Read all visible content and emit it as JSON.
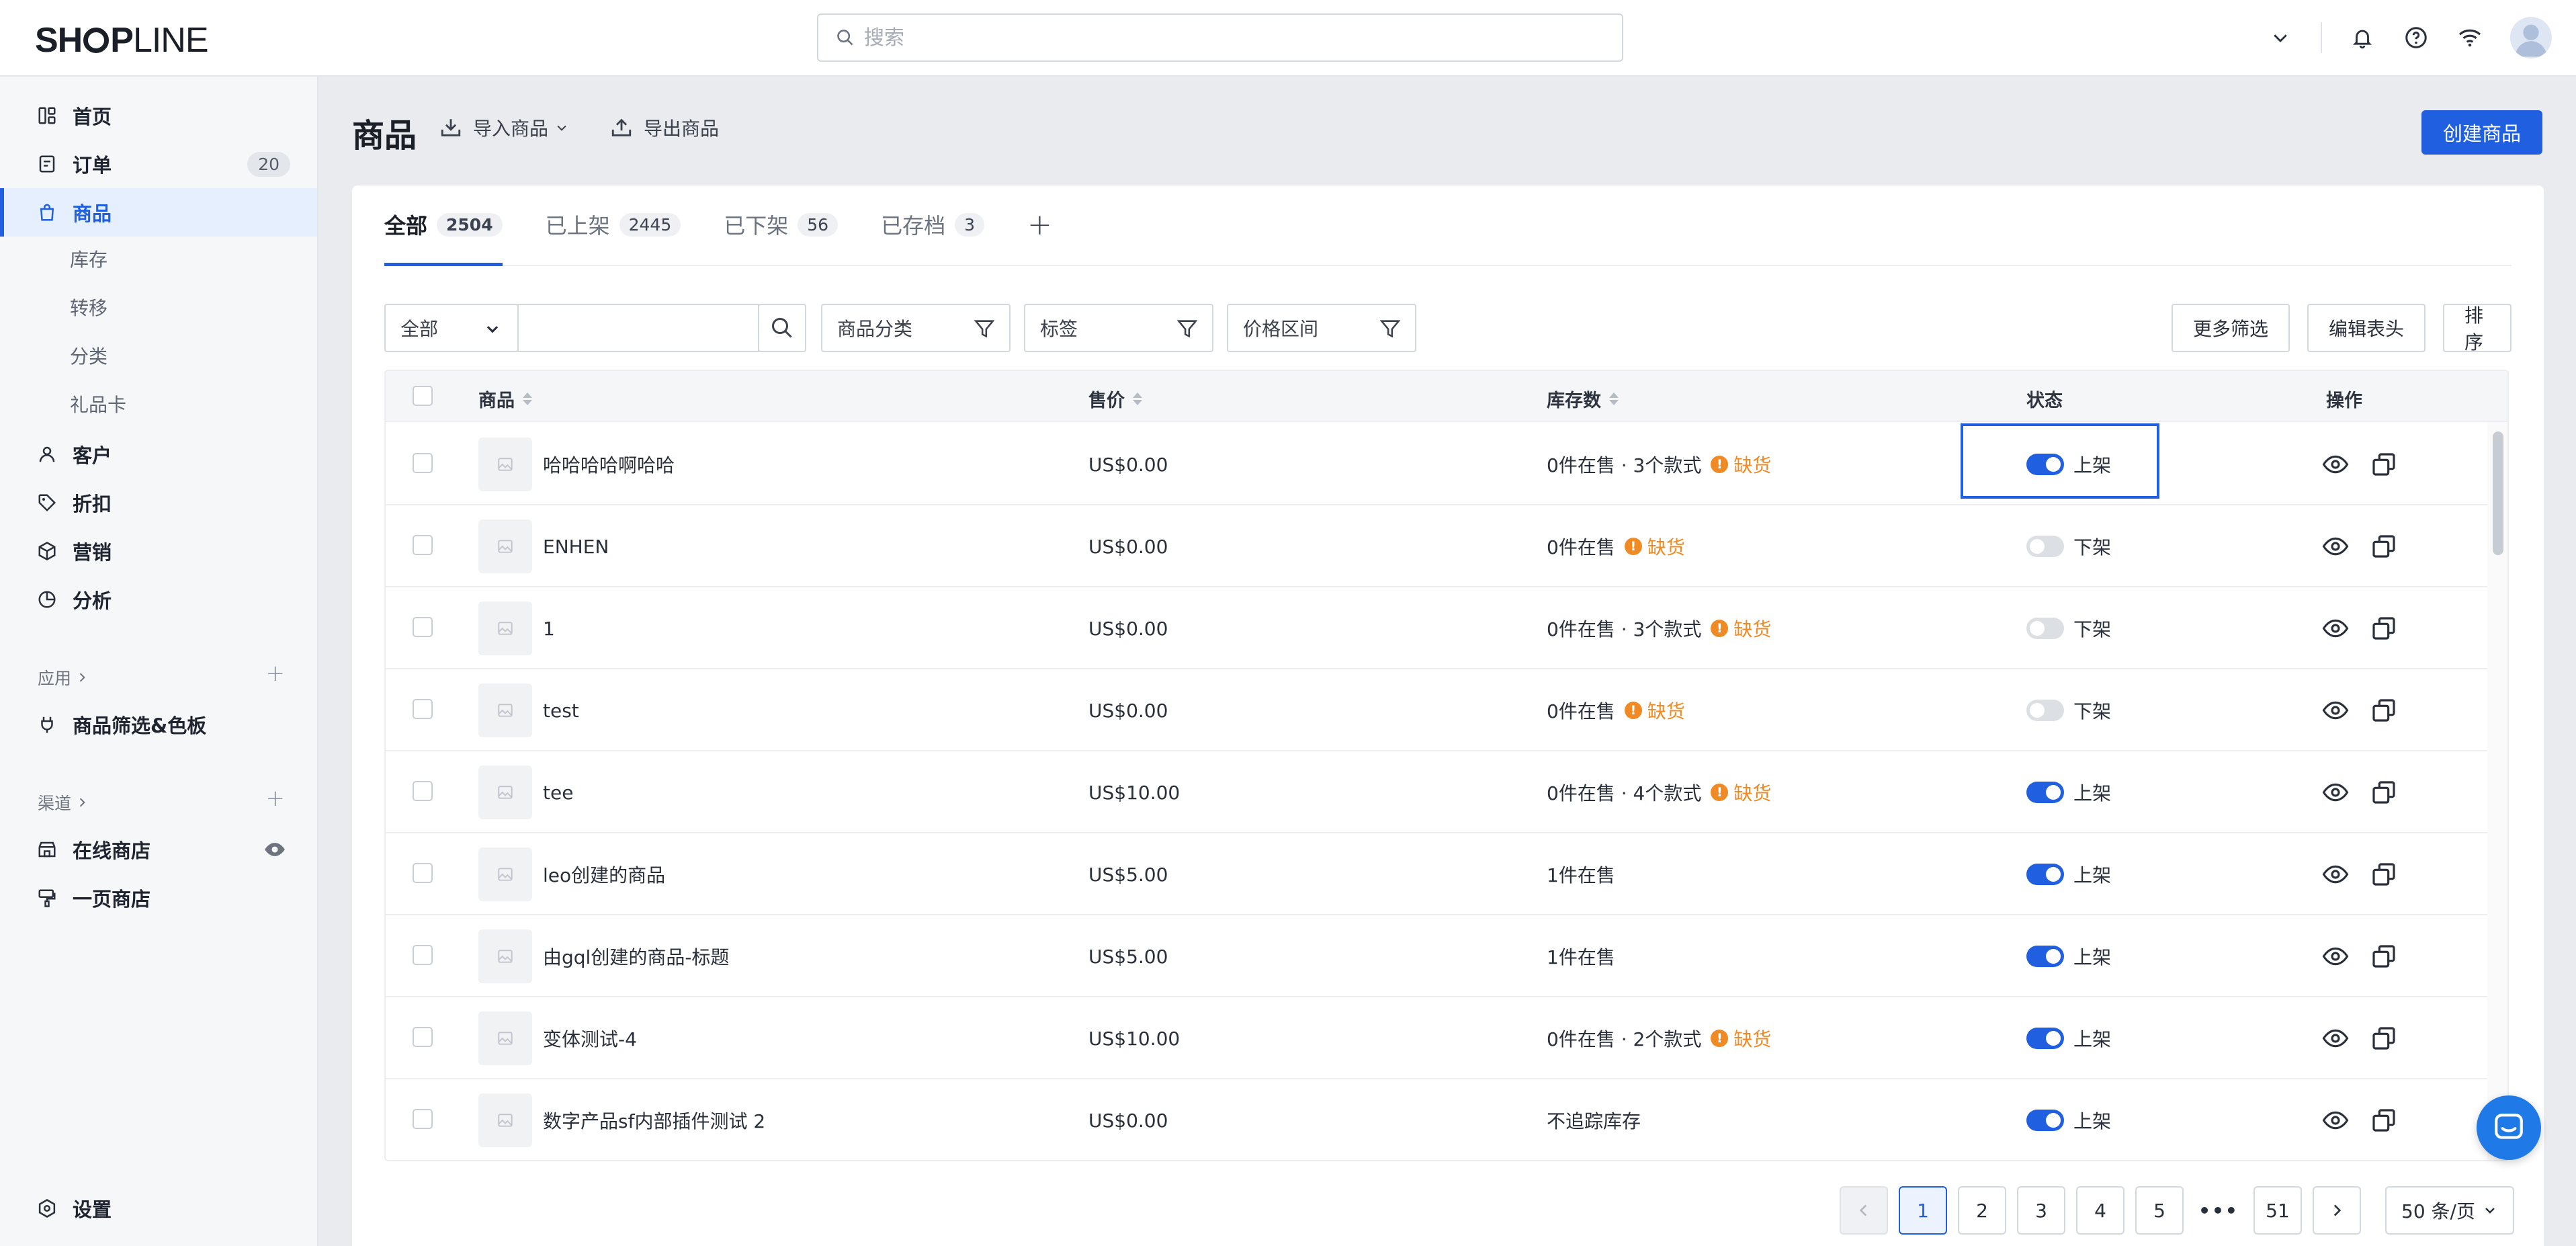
{
  "app": {
    "logo_text": "SHOPLINE"
  },
  "header": {
    "search_placeholder": "搜索"
  },
  "sidebar": {
    "items": [
      {
        "label": "首页",
        "icon": "dashboard-icon"
      },
      {
        "label": "订单",
        "icon": "order-icon",
        "badge": "20"
      },
      {
        "label": "商品",
        "icon": "bag-icon",
        "active": true
      }
    ],
    "sub_items": [
      "库存",
      "转移",
      "分类",
      "礼品卡"
    ],
    "items2": [
      {
        "label": "客户",
        "icon": "user-icon"
      },
      {
        "label": "折扣",
        "icon": "tag-icon"
      },
      {
        "label": "营销",
        "icon": "box-icon"
      },
      {
        "label": "分析",
        "icon": "pie-icon"
      }
    ],
    "apps_label": "应用",
    "apps": [
      {
        "label": "商品筛选&色板",
        "icon": "plug-icon"
      }
    ],
    "channels_label": "渠道",
    "channels": [
      {
        "label": "在线商店",
        "icon": "store-icon"
      },
      {
        "label": "一页商店",
        "icon": "page-store-icon"
      }
    ],
    "settings_label": "设置"
  },
  "main": {
    "title": "商品",
    "import_label": "导入商品",
    "export_label": "导出商品",
    "create_label": "创建商品",
    "tabs": [
      {
        "label": "全部",
        "count": "2504"
      },
      {
        "label": "已上架",
        "count": "2445"
      },
      {
        "label": "已下架",
        "count": "56"
      },
      {
        "label": "已存档",
        "count": "3"
      }
    ],
    "filters": {
      "scope_value": "全部",
      "search_value": "",
      "category": "商品分类",
      "tag": "标签",
      "price": "价格区间",
      "more": "更多筛选",
      "edit_columns": "编辑表头",
      "sort": "排序"
    },
    "table": {
      "columns": {
        "product": "商品",
        "price": "售价",
        "stock": "库存数",
        "status": "状态",
        "actions": "操作"
      },
      "rows": [
        {
          "name": "哈哈哈哈啊哈哈",
          "price": "US$0.00",
          "stock": "0件在售 · 3个款式",
          "warn": "缺货",
          "status": "上架",
          "on": true
        },
        {
          "name": "ENHEN",
          "price": "US$0.00",
          "stock": "0件在售",
          "warn": "缺货",
          "status": "下架",
          "on": false
        },
        {
          "name": "1",
          "price": "US$0.00",
          "stock": "0件在售 · 3个款式",
          "warn": "缺货",
          "status": "下架",
          "on": false
        },
        {
          "name": "test",
          "price": "US$0.00",
          "stock": "0件在售",
          "warn": "缺货",
          "status": "下架",
          "on": false
        },
        {
          "name": "tee",
          "price": "US$10.00",
          "stock": "0件在售 · 4个款式",
          "warn": "缺货",
          "status": "上架",
          "on": true
        },
        {
          "name": "leo创建的商品",
          "price": "US$5.00",
          "stock": "1件在售",
          "warn": "",
          "status": "上架",
          "on": true
        },
        {
          "name": "由gql创建的商品-标题",
          "price": "US$5.00",
          "stock": "1件在售",
          "warn": "",
          "status": "上架",
          "on": true
        },
        {
          "name": "变体测试-4",
          "price": "US$10.00",
          "stock": "0件在售 · 2个款式",
          "warn": "缺货",
          "status": "上架",
          "on": true
        },
        {
          "name": "数字产品sf内部插件测试 2",
          "price": "US$0.00",
          "stock": "不追踪库存",
          "warn": "",
          "status": "上架",
          "on": true
        }
      ]
    },
    "pagination": {
      "pages": [
        "1",
        "2",
        "3",
        "4",
        "5"
      ],
      "current": "1",
      "ellipsis": "•••",
      "last": "51",
      "page_size": "50 条/页"
    }
  },
  "colors": {
    "accent": "#1f5fe0",
    "warning": "#f08a24"
  }
}
